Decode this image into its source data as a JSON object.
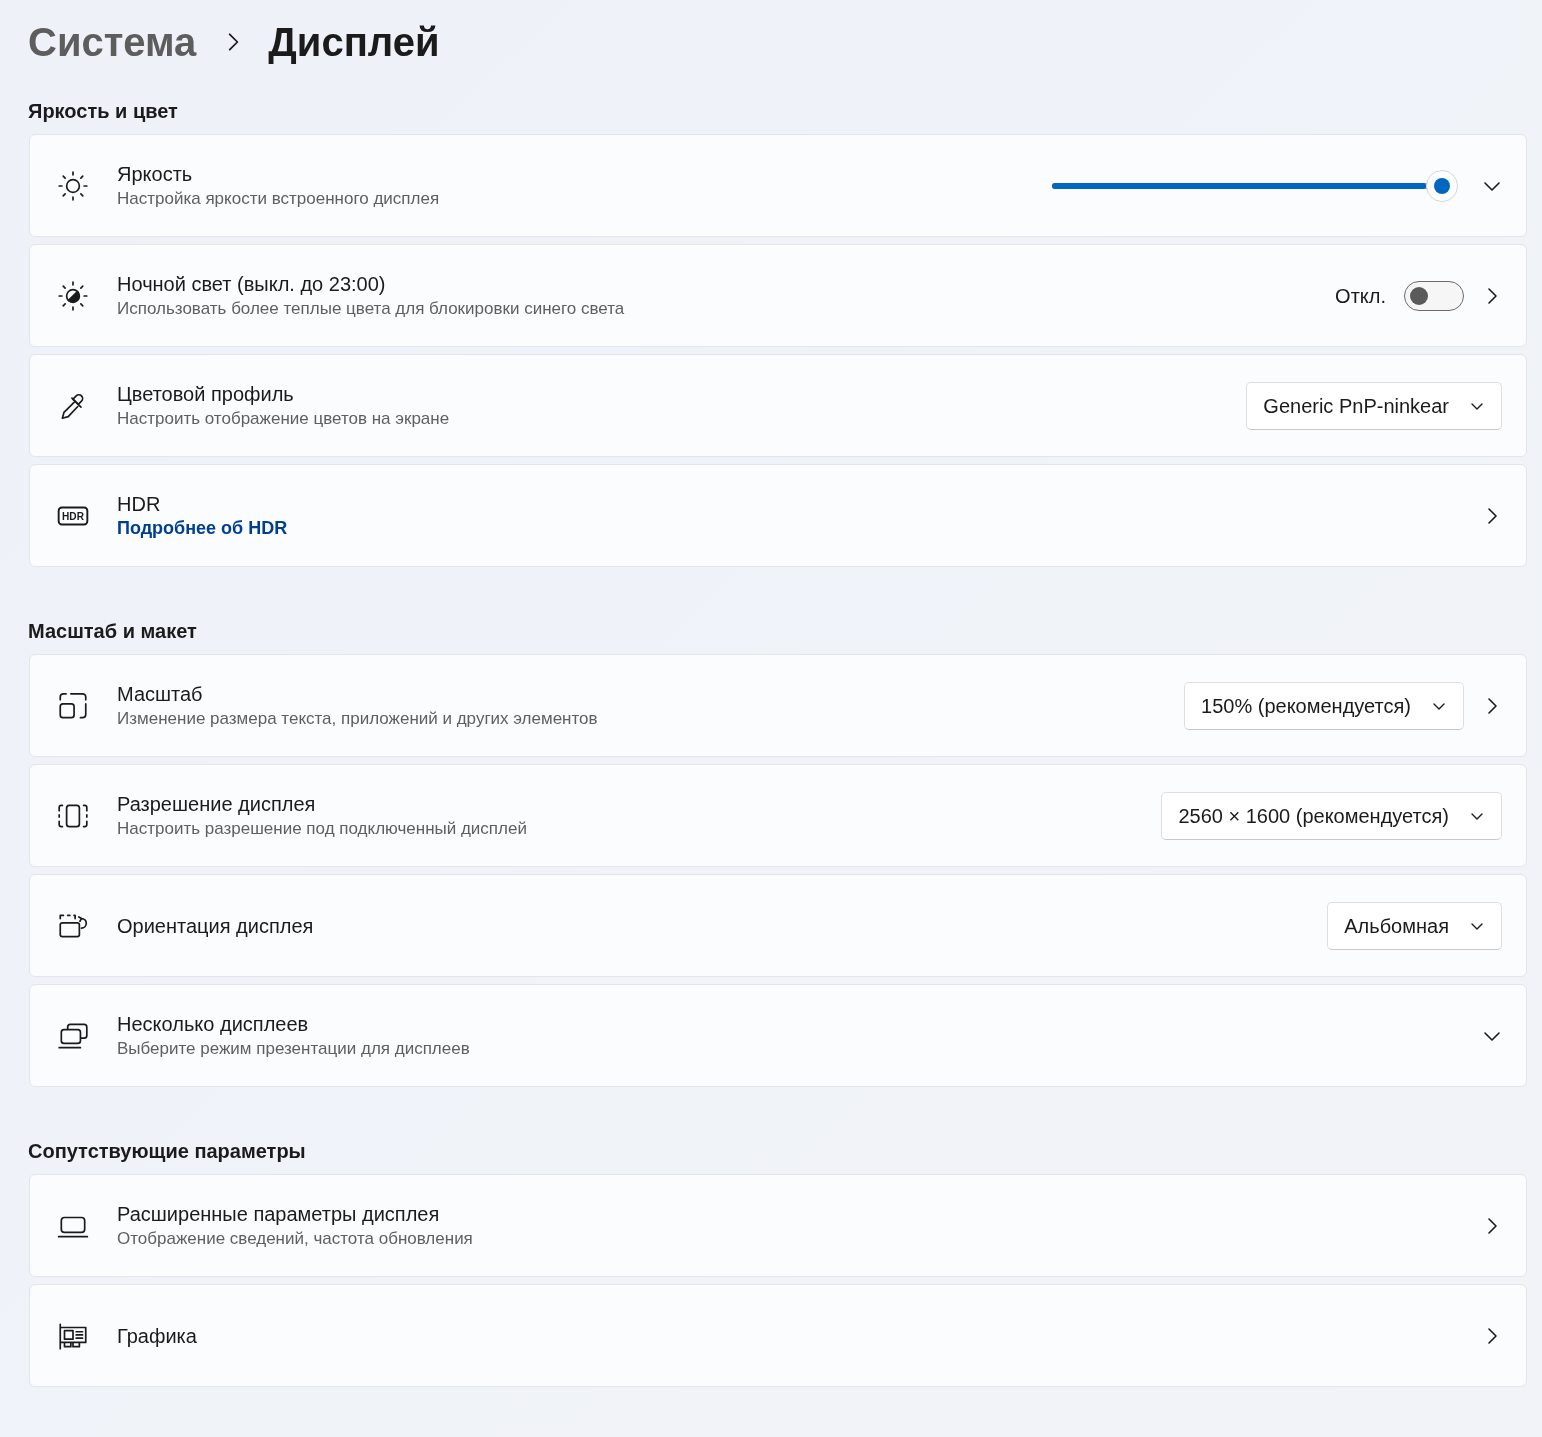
{
  "breadcrumb": {
    "parent": "Система",
    "current": "Дисплей"
  },
  "sections": [
    {
      "title": "Яркость и цвет",
      "rows": [
        {
          "kind": "slider",
          "title": "Яркость",
          "subtitle": "Настройка яркости встроенного дисплея",
          "level": 1.0,
          "expandable": true
        },
        {
          "kind": "toggle",
          "title": "Ночной свет (выкл. до 23:00)",
          "subtitle": "Использовать более теплые цвета для блокировки синего света",
          "state_label": "Откл.",
          "on": false,
          "opens_page": true
        },
        {
          "kind": "dropdown",
          "title": "Цветовой профиль",
          "subtitle": "Настроить отображение цветов на экране",
          "value": "Generic PnP-ninkear"
        },
        {
          "kind": "link",
          "icon_label": "HDR",
          "title": "HDR",
          "link": "Подробнее об HDR",
          "opens_page": true
        }
      ]
    },
    {
      "title": "Масштаб и макет",
      "rows": [
        {
          "kind": "dropdown",
          "title": "Масштаб",
          "subtitle": "Изменение размера текста, приложений и других элементов",
          "value": "150% (рекомендуется)",
          "opens_page": true
        },
        {
          "kind": "dropdown",
          "title": "Разрешение дисплея",
          "subtitle": "Настроить разрешение под подключенный дисплей",
          "value": "2560 × 1600 (рекомендуется)"
        },
        {
          "kind": "dropdown",
          "title": "Ориентация дисплея",
          "value": "Альбомная"
        },
        {
          "kind": "plain",
          "title": "Несколько дисплеев",
          "subtitle": "Выберите режим презентации для дисплеев",
          "expandable": true
        }
      ]
    },
    {
      "title": "Сопутствующие параметры",
      "rows": [
        {
          "kind": "plain",
          "title": "Расширенные параметры дисплея",
          "subtitle": "Отображение сведений, частота обновления",
          "opens_page": true
        },
        {
          "kind": "plain",
          "title": "Графика",
          "opens_page": true
        }
      ]
    }
  ]
}
